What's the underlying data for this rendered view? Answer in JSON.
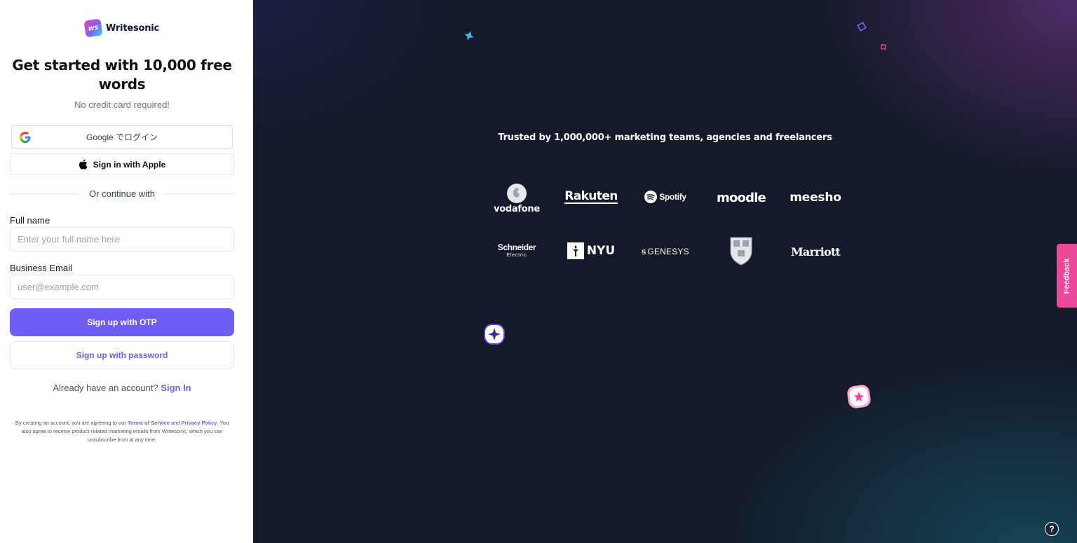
{
  "brand": {
    "name": "Writesonic",
    "logo_text": "WS"
  },
  "headline": "Get started with 10,000 free words",
  "subline": "No credit card required!",
  "google_button": {
    "label": "Google でログイン"
  },
  "apple_button": {
    "label": "Sign in with Apple"
  },
  "divider_text": "Or continue with",
  "form": {
    "full_name_label": "Full name",
    "full_name_placeholder": "Enter your full name here",
    "email_label": "Business Email",
    "email_placeholder": "user@example.com"
  },
  "otp_button": "Sign up with OTP",
  "password_button": "Sign up with password",
  "have_account": {
    "text": "Already have an account?",
    "link": "Sign In"
  },
  "legal": {
    "prefix": "By creating an account, you are agreeing to our",
    "terms": "Terms of Service",
    "and": "and",
    "privacy": "Privacy Policy",
    "suffix": ". You also agree to receive product-related marketing emails from Writesonic, which you can unsubscribe from at any time."
  },
  "trusted_text": "Trusted by 1,000,000+ marketing teams, agencies and freelancers",
  "logos": {
    "vodafone": "vodafone",
    "rakuten": "Rakuten",
    "spotify": "Spotify",
    "moodle": "moodle",
    "meesho": "meesho",
    "schneider_top": "Schneider",
    "schneider_bottom": "Electric",
    "nyu": "NYU",
    "genesys": "GENESYS",
    "marriott": "Marriott"
  },
  "feedback_tab": "Feedback",
  "help_icon": "?",
  "colors": {
    "accent": "#6e5ef5",
    "feedback": "#ec4899",
    "panel_dark": "#141a2a"
  }
}
